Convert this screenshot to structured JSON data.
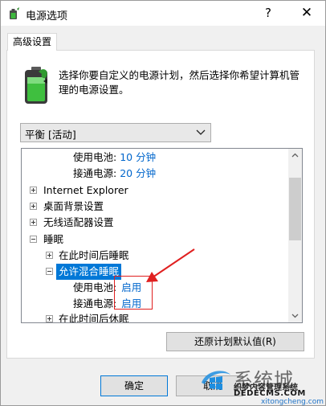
{
  "window": {
    "title": "电源选项",
    "help_glyph": "?",
    "close_glyph": "✕"
  },
  "tab": {
    "label": "高级设置"
  },
  "description": "选择你要自定义的电源计划，然后选择你希望计算机管理的电源设置。",
  "plan_select": {
    "value": "平衡 [活动]"
  },
  "tree": {
    "rows": [
      {
        "label": "使用电池:",
        "value": "10 分钟"
      },
      {
        "label": "接通电源:",
        "value": "20 分钟"
      },
      {
        "label": "Internet Explorer"
      },
      {
        "label": "桌面背景设置"
      },
      {
        "label": "无线适配器设置"
      },
      {
        "label": "睡眠"
      },
      {
        "label": "在此时间后睡眠"
      },
      {
        "label": "允许混合睡眠"
      },
      {
        "label": "使用电池:",
        "value": "启用"
      },
      {
        "label": "接通电源:",
        "value": "启用"
      },
      {
        "label": "在此时间后休眠"
      }
    ]
  },
  "buttons": {
    "restore": "还原计划默认值(R)",
    "ok": "确定",
    "cancel": "取消"
  },
  "watermark": {
    "big": "系统城",
    "cn": "织梦内容管理系统",
    "url": "DEDECMS.COM",
    "url2": "xitongcheng.com"
  },
  "colors": {
    "accent": "#0078d7",
    "value_link": "#0066cc",
    "annotation": "#e02020"
  }
}
